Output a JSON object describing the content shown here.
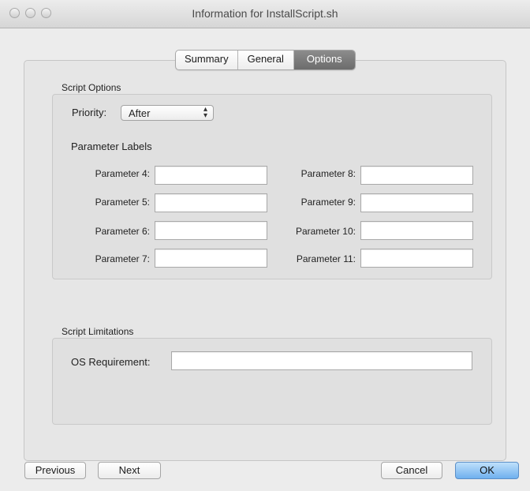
{
  "window": {
    "title": "Information for InstallScript.sh"
  },
  "tabs": [
    "Summary",
    "General",
    "Options"
  ],
  "active_tab": "Options",
  "script_options": {
    "section_label": "Script Options",
    "priority_label": "Priority:",
    "priority_value": "After",
    "parameter_labels_heading": "Parameter Labels",
    "parameters": [
      {
        "label": "Parameter 4:",
        "value": ""
      },
      {
        "label": "Parameter 5:",
        "value": ""
      },
      {
        "label": "Parameter 6:",
        "value": ""
      },
      {
        "label": "Parameter 7:",
        "value": ""
      },
      {
        "label": "Parameter 8:",
        "value": ""
      },
      {
        "label": "Parameter 9:",
        "value": ""
      },
      {
        "label": "Parameter 10:",
        "value": ""
      },
      {
        "label": "Parameter 11:",
        "value": ""
      }
    ]
  },
  "script_limitations": {
    "section_label": "Script Limitations",
    "os_requirement_label": "OS Requirement:",
    "os_requirement_value": ""
  },
  "buttons": {
    "previous": "Previous",
    "next": "Next",
    "cancel": "Cancel",
    "ok": "OK"
  },
  "icons": {
    "popup_arrows": "up-down-arrows-icon",
    "window_controls": "traffic-light-icons"
  },
  "colors": {
    "default_button": "#6fb0ee",
    "active_tab": "#7a7a7a"
  }
}
